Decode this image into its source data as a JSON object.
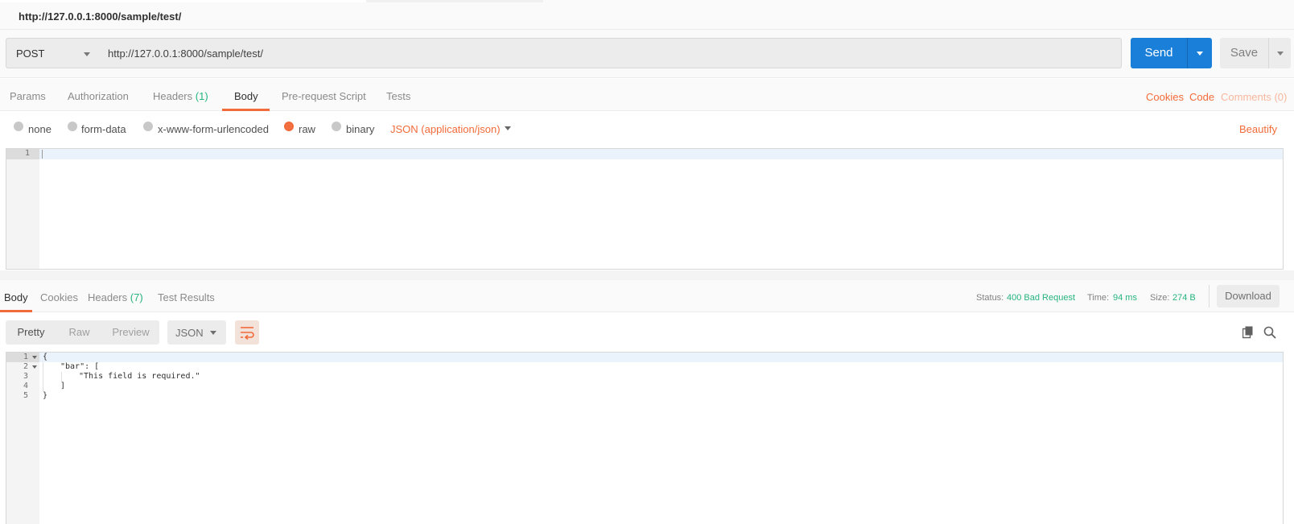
{
  "window": {
    "tab_title": "http://127.0.0.1:8000/sample/test/"
  },
  "request": {
    "method": "POST",
    "url": "http://127.0.0.1:8000/sample/test/",
    "send_label": "Send",
    "save_label": "Save"
  },
  "request_tabs": {
    "items": [
      {
        "label": "Params",
        "count": ""
      },
      {
        "label": "Authorization",
        "count": ""
      },
      {
        "label": "Headers",
        "count": "(1)"
      },
      {
        "label": "Body",
        "count": ""
      },
      {
        "label": "Pre-request Script",
        "count": ""
      },
      {
        "label": "Tests",
        "count": ""
      }
    ],
    "active": "Body",
    "right_links": [
      "Cookies",
      "Code",
      "Comments (0)"
    ]
  },
  "body_options": {
    "modes": [
      "none",
      "form-data",
      "x-www-form-urlencoded",
      "raw",
      "binary"
    ],
    "selected": "raw",
    "content_type": "JSON (application/json)",
    "beautify_label": "Beautify"
  },
  "request_editor": {
    "line_numbers": [
      "1"
    ],
    "content": ""
  },
  "response_tabs": {
    "items": [
      {
        "label": "Body",
        "count": ""
      },
      {
        "label": "Cookies",
        "count": ""
      },
      {
        "label": "Headers",
        "count": "(7)"
      },
      {
        "label": "Test Results",
        "count": ""
      }
    ],
    "active": "Body"
  },
  "response_meta": {
    "status_label": "Status:",
    "status_value": "400 Bad Request",
    "time_label": "Time:",
    "time_value": "94 ms",
    "size_label": "Size:",
    "size_value": "274 B",
    "download_label": "Download"
  },
  "response_view": {
    "modes": [
      "Pretty",
      "Raw",
      "Preview"
    ],
    "active_mode": "Pretty",
    "format": "JSON"
  },
  "response_body": {
    "line_numbers": [
      "1",
      "2",
      "3",
      "4",
      "5"
    ],
    "lines": [
      "{",
      "\"bar\": [",
      "\"This field is required.\"",
      "]",
      "}"
    ]
  },
  "icons": [
    "caret-down-icon",
    "wrap-lines-icon",
    "copy-icon",
    "search-icon"
  ],
  "colors": {
    "accent": "#f26b3a",
    "primary": "#1a7fd8",
    "success": "#26b47f"
  }
}
